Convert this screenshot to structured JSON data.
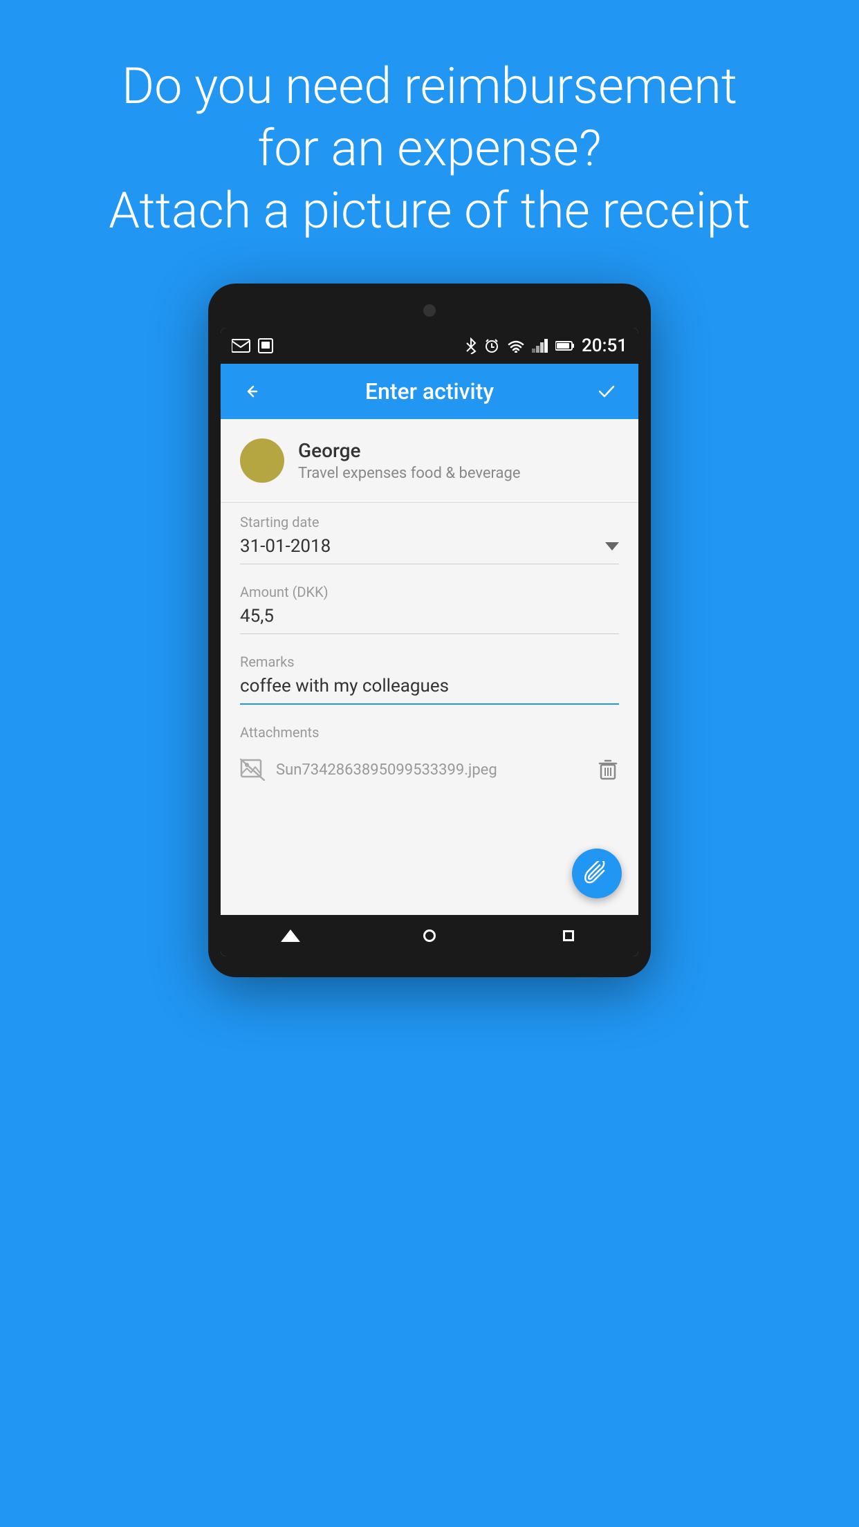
{
  "hero": {
    "line1": "Do you need reimbursement",
    "line2": "for an expense?",
    "line3": "Attach a picture of the receipt"
  },
  "status_bar": {
    "time": "20:51"
  },
  "app_bar": {
    "title": "Enter activity",
    "back_label": "←",
    "confirm_label": "✓"
  },
  "user": {
    "name": "George",
    "subtitle": "Travel expenses food & beverage",
    "avatar_color": "#b5a642"
  },
  "fields": {
    "starting_date_label": "Starting date",
    "starting_date_value": "31-01-2018",
    "amount_label": "Amount (DKK)",
    "amount_value": "45,5",
    "remarks_label": "Remarks",
    "remarks_value": "coffee with my colleagues",
    "attachments_label": "Attachments",
    "attachment_filename": "Sun7342863895099533399.jpeg"
  },
  "colors": {
    "primary": "#2196F3",
    "background": "#2196F3",
    "surface": "#f5f5f5",
    "avatar": "#b5a642"
  }
}
